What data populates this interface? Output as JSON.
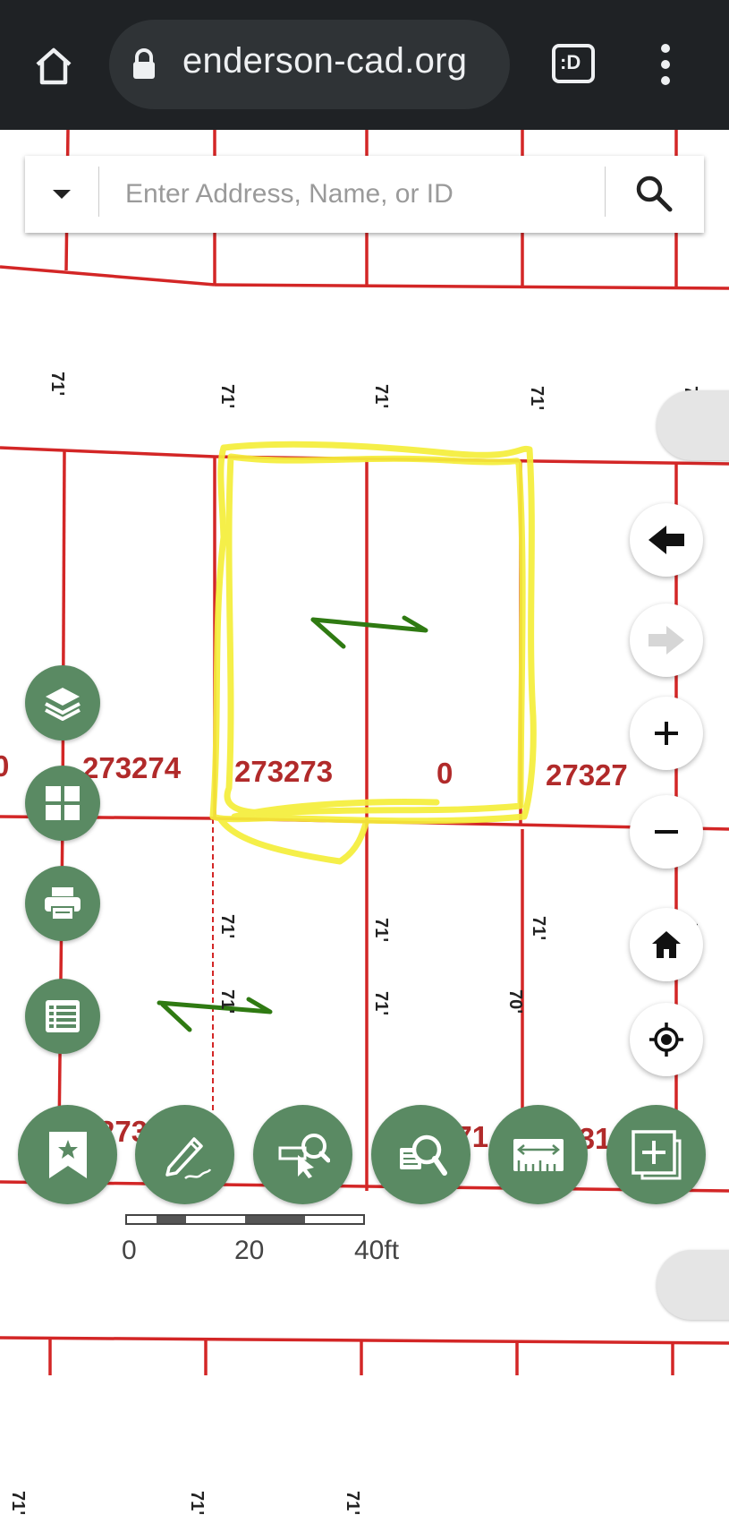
{
  "browser": {
    "url": "enderson-cad.org",
    "home_icon": "home-icon",
    "lock_icon": "lock-icon",
    "tab_switcher_label": ":D",
    "menu_icon": "more-vert-icon"
  },
  "search": {
    "placeholder": "Enter Address, Name, or ID",
    "dropdown_icon": "caret-down-icon",
    "search_icon": "search-icon"
  },
  "parcels": [
    {
      "id": "0"
    },
    {
      "id": "273274"
    },
    {
      "id": "273273"
    },
    {
      "id": "0"
    },
    {
      "id": "27327"
    },
    {
      "id": "273182"
    },
    {
      "id": "0"
    },
    {
      "id": "303271"
    },
    {
      "id": "27318"
    }
  ],
  "dimensions": {
    "d71": "71'",
    "d70": "70'"
  },
  "left_tools": [
    {
      "name": "layers",
      "icon": "layers-icon"
    },
    {
      "name": "basemap",
      "icon": "grid-icon"
    },
    {
      "name": "print",
      "icon": "print-icon"
    },
    {
      "name": "table",
      "icon": "list-icon"
    }
  ],
  "bottom_tools": [
    {
      "name": "bookmarks",
      "icon": "bookmark-star-icon"
    },
    {
      "name": "draw",
      "icon": "pencil-icon"
    },
    {
      "name": "select",
      "icon": "select-search-icon"
    },
    {
      "name": "query",
      "icon": "query-search-icon"
    },
    {
      "name": "measure",
      "icon": "ruler-icon"
    },
    {
      "name": "add-data",
      "icon": "add-layer-icon"
    }
  ],
  "nav_controls": [
    {
      "name": "back",
      "icon": "arrow-left-icon"
    },
    {
      "name": "forward",
      "icon": "arrow-right-icon",
      "disabled": true
    },
    {
      "name": "zoom-in",
      "icon": "plus-icon"
    },
    {
      "name": "zoom-out",
      "icon": "minus-icon"
    },
    {
      "name": "home",
      "icon": "home-icon"
    },
    {
      "name": "locate",
      "icon": "locate-icon"
    }
  ],
  "scale": {
    "labels": [
      "0",
      "20",
      "40ft"
    ]
  },
  "colors": {
    "parcel_line": "#d32626",
    "parcel_label": "#b12a2a",
    "tool_green": "#5a8a63",
    "highlight": "#f5ee3a",
    "annotation_arrow": "#2f7a12",
    "browser_bar": "#1f2225"
  }
}
